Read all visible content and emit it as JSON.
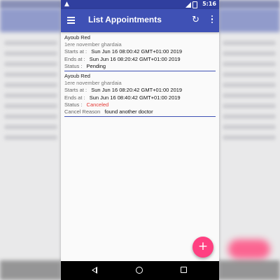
{
  "status_bar": {
    "time": "5:16"
  },
  "app_bar": {
    "title": "List Appointments"
  },
  "labels": {
    "starts_at": "Starts at :",
    "ends_at": "Ends at :",
    "status": "Status :",
    "cancel_reason": "Cancel Reason"
  },
  "appointments": [
    {
      "name": "Ayoub Red",
      "address": "1ere november ghardaia",
      "starts_at": "Sun Jun 16 08:00:42 GMT+01:00 2019",
      "ends_at": "Sun Jun 16 08:20:42 GMT+01:00 2019",
      "status": "Pending"
    },
    {
      "name": "Ayoub Red",
      "address": "1ere november ghardaia",
      "starts_at": "Sun Jun 16 08:20:42 GMT+01:00 2019",
      "ends_at": "Sun Jun 16 08:40:42 GMT+01:00 2019",
      "status": "Canceled",
      "cancel_reason": "found another doctor"
    }
  ],
  "fab": {
    "symbol": "+"
  },
  "colors": {
    "primary": "#3f51b5",
    "primary_dark": "#303f9f",
    "accent": "#ff4081",
    "canceled": "#e53935"
  },
  "icons": [
    "warning-icon",
    "signal-icon",
    "battery-icon",
    "menu-icon",
    "refresh-icon",
    "more-vert-icon",
    "add-icon",
    "nav-back-icon",
    "nav-home-icon",
    "nav-recent-icon"
  ]
}
